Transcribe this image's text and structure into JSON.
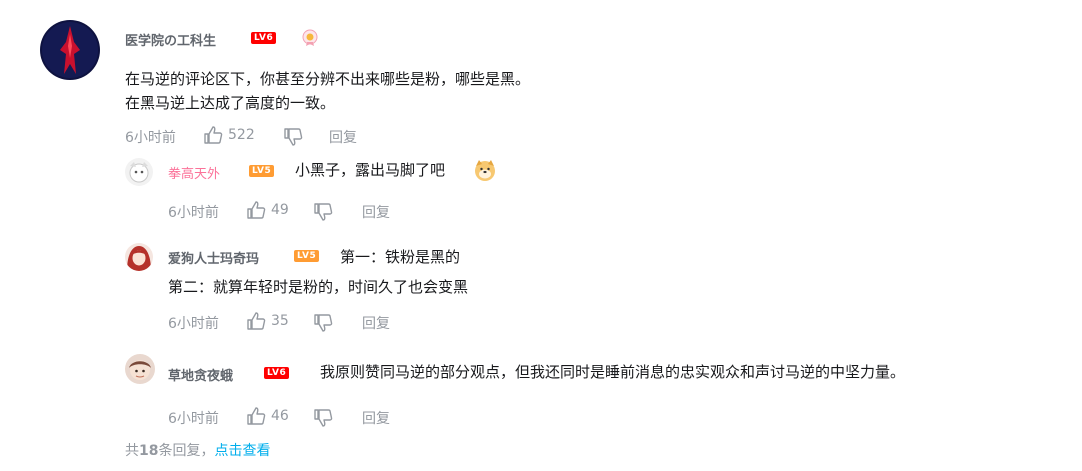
{
  "main_comment": {
    "username": "医学院の工科生",
    "level": "LV6",
    "text_line1": "在马逆的评论区下，你甚至分辨不出来哪些是粉，哪些是黑。",
    "text_line2": "在黑马逆上达成了高度的一致。",
    "time": "6小时前",
    "likes": "522",
    "reply_label": "回复"
  },
  "replies": [
    {
      "username": "拳高天外",
      "level": "LV5",
      "text": "小黑子，露出马脚了吧",
      "time": "6小时前",
      "likes": "49",
      "reply_label": "回复"
    },
    {
      "username": "爱狗人士玛奇玛",
      "level": "LV5",
      "text_line1": "第一：铁粉是黑的",
      "text_line2": "第二：就算年轻时是粉的，时间久了也会变黑",
      "time": "6小时前",
      "likes": "35",
      "reply_label": "回复"
    },
    {
      "username": "草地贪夜蛾",
      "level": "LV6",
      "text": "我原则赞同马逆的部分观点，但我还同时是睡前消息的忠实观众和声讨马逆的中坚力量。",
      "time": "6小时前",
      "likes": "46",
      "reply_label": "回复"
    }
  ],
  "footer": {
    "prefix": "共",
    "count": "18",
    "suffix": "条回复，",
    "link": "点击查看"
  },
  "colors": {
    "accent": "#00aeec",
    "pink": "#fb7299",
    "lv6": "#ff0000",
    "lv5": "#ff9c33",
    "meta": "#9499a0"
  }
}
